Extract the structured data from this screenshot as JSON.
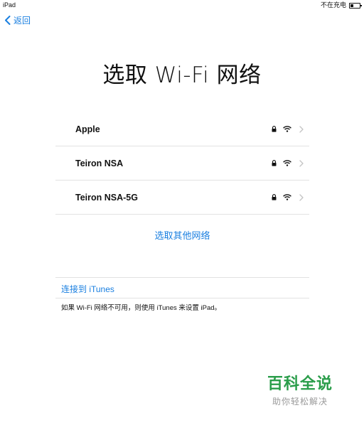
{
  "status_bar": {
    "device": "iPad",
    "charging": "不在充电"
  },
  "back": {
    "label": "返回"
  },
  "title": "选取 Wi-Fi 网络",
  "networks": [
    {
      "name": "Apple",
      "secured": true
    },
    {
      "name": "Teiron NSA",
      "secured": true
    },
    {
      "name": "Teiron NSA-5G",
      "secured": true
    }
  ],
  "other_network": "选取其他网络",
  "itunes": {
    "link": "连接到 iTunes",
    "note": "如果 Wi-Fi 网络不可用，则使用 iTunes 来设置 iPad。"
  },
  "watermark": {
    "title": "百科全说",
    "subtitle": "助你轻松解决"
  },
  "colors": {
    "accent": "#1a7fe0",
    "watermark": "#2a9d4a"
  }
}
